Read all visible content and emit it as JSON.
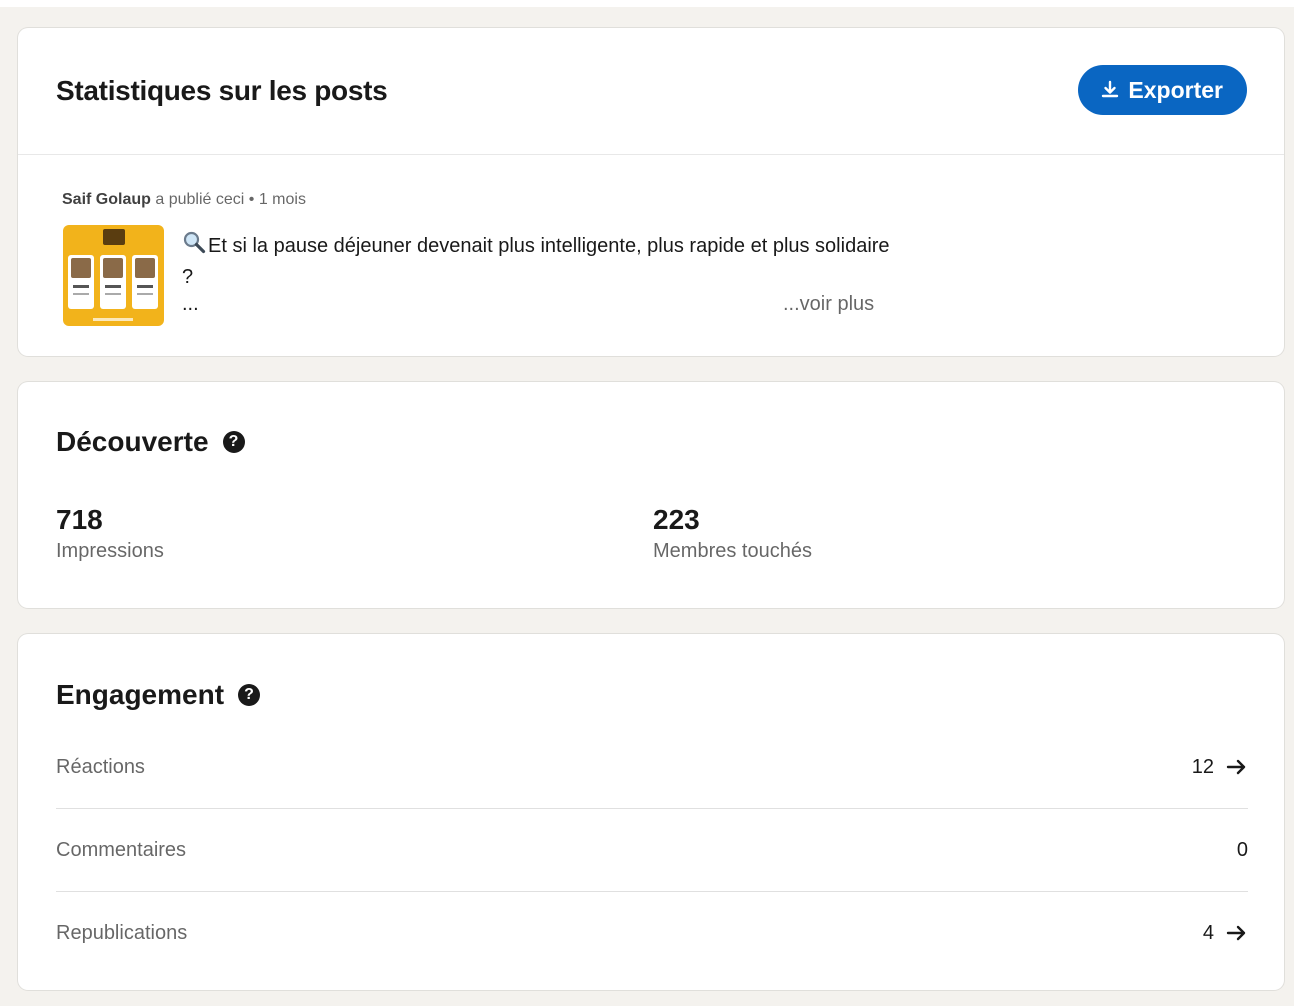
{
  "header": {
    "title": "Statistiques sur les posts",
    "export_label": "Exporter"
  },
  "post": {
    "author": "Saif Golaup",
    "action": "a publié ceci",
    "separator": "•",
    "age": "1 mois",
    "text": "Et si la pause déjeuner devenait plus intelligente, plus rapide et plus solidaire ?",
    "ellipsis": "...",
    "see_more": "...voir plus",
    "emoji_icon": "magnifying-glass-icon",
    "thumbnail_color": "#f2b31b"
  },
  "discovery": {
    "title": "Découverte",
    "help": "?",
    "metrics": [
      {
        "value": "718",
        "label": "Impressions"
      },
      {
        "value": "223",
        "label": "Membres touchés"
      }
    ]
  },
  "engagement": {
    "title": "Engagement",
    "help": "?",
    "rows": [
      {
        "label": "Réactions",
        "value": "12",
        "has_arrow": true
      },
      {
        "label": "Commentaires",
        "value": "0",
        "has_arrow": false
      },
      {
        "label": "Republications",
        "value": "4",
        "has_arrow": true
      }
    ]
  },
  "colors": {
    "accent": "#0a66c2",
    "background": "#f4f2ee"
  }
}
